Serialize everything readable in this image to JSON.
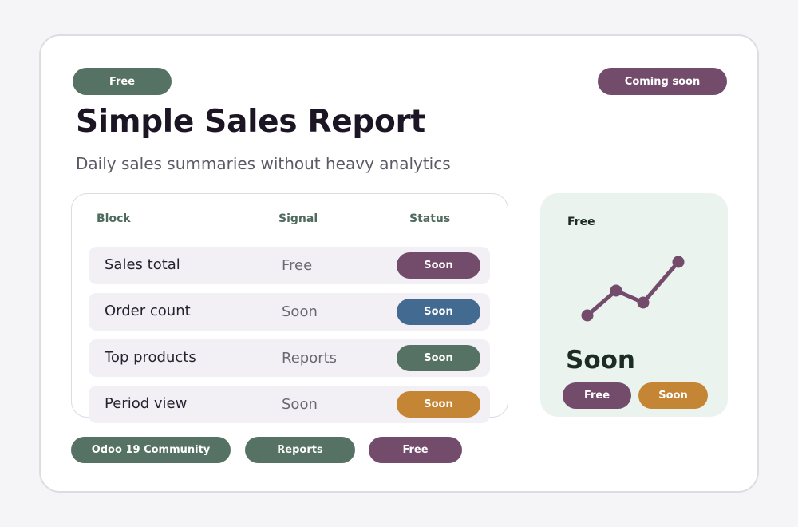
{
  "header": {
    "badge_left": "Free",
    "badge_right": "Coming soon",
    "title": "Simple Sales Report",
    "subtitle": "Daily sales summaries without heavy analytics"
  },
  "table": {
    "columns": [
      "Block",
      "Signal",
      "Status"
    ],
    "rows": [
      {
        "block": "Sales total",
        "signal": "Free",
        "status": "Soon",
        "status_color": "#744c6b"
      },
      {
        "block": "Order count",
        "signal": "Soon",
        "status": "Soon",
        "status_color": "#436a90"
      },
      {
        "block": "Top products",
        "signal": "Reports",
        "status": "Soon",
        "status_color": "#557264"
      },
      {
        "block": "Period view",
        "signal": "Soon",
        "status": "Soon",
        "status_color": "#c48635"
      }
    ]
  },
  "side": {
    "label": "Free",
    "value": "Soon",
    "chart_icon": "trend-line-icon",
    "chip_left": "Free",
    "chip_right": "Soon"
  },
  "footer_tags": [
    "Odoo 19 Community",
    "Reports",
    "Free"
  ],
  "colors": {
    "green": "#557264",
    "plum": "#744c6b",
    "blue": "#436a90",
    "amber": "#c48635",
    "panel_bg": "#ebf3ef"
  }
}
